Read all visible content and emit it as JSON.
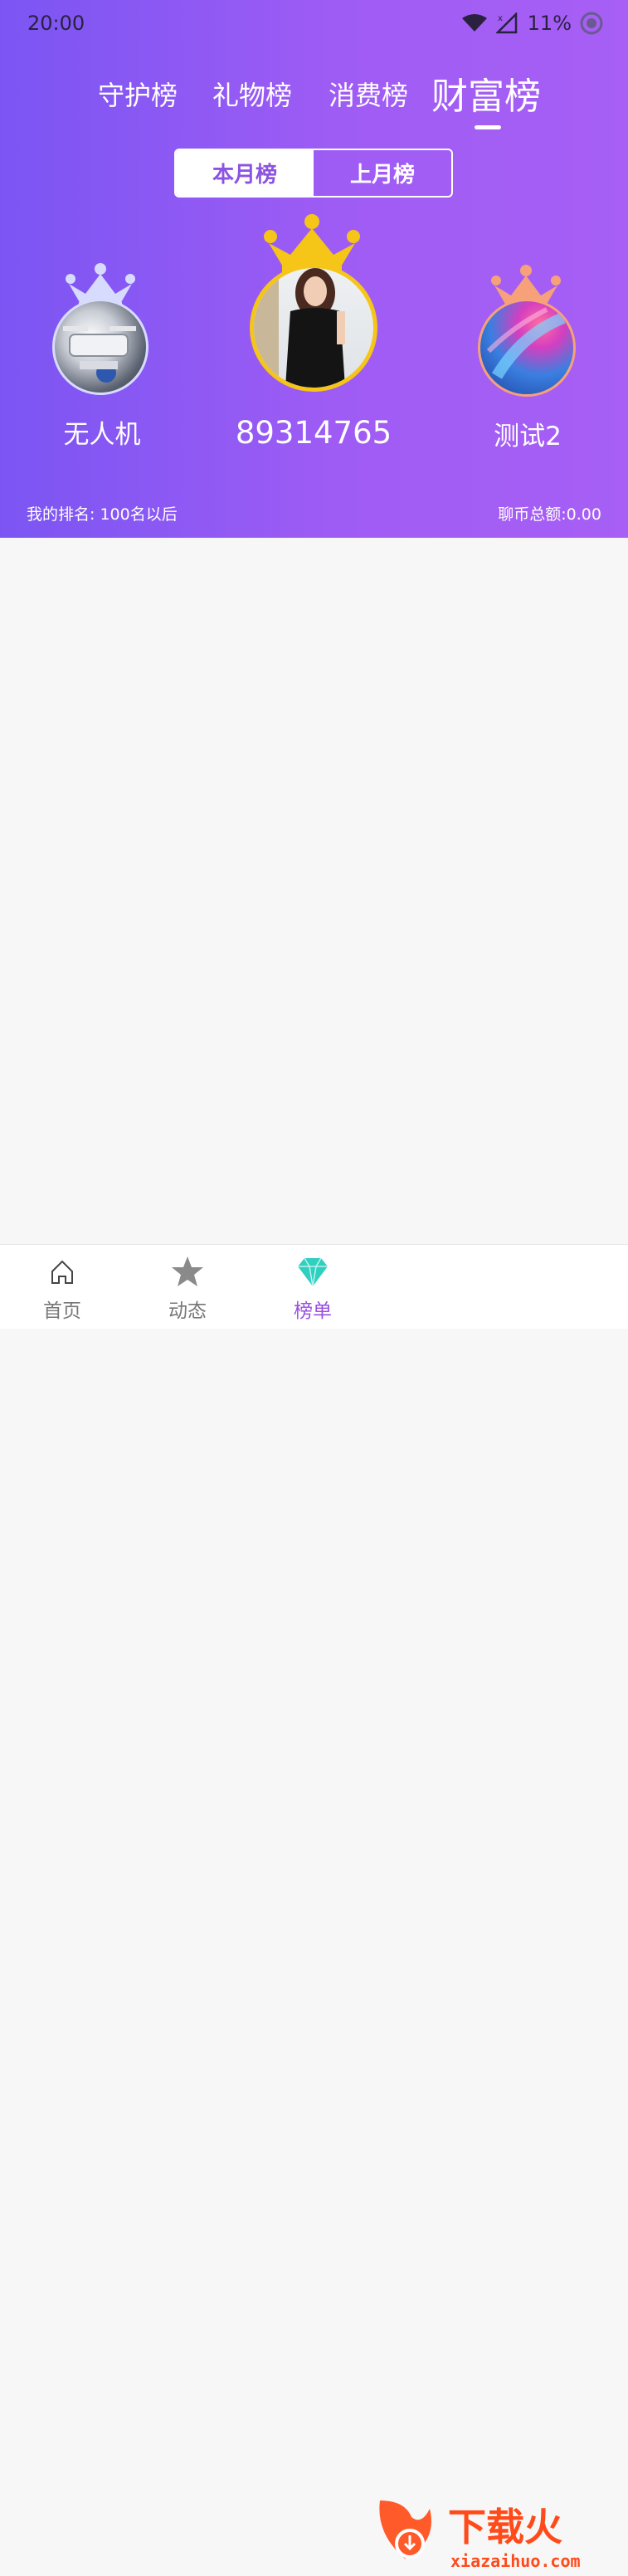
{
  "status_bar": {
    "time": "20:00",
    "battery": "11%"
  },
  "tabs": [
    {
      "label": "守护榜"
    },
    {
      "label": "礼物榜"
    },
    {
      "label": "消费榜"
    },
    {
      "label": "财富榜",
      "active": true
    }
  ],
  "period_toggle": {
    "this_month": "本月榜",
    "last_month": "上月榜",
    "selected": "本月榜"
  },
  "podium": {
    "first": {
      "name": "89314765",
      "crown": "gold-crown-icon"
    },
    "second": {
      "name": "无人机",
      "crown": "silver-crown-icon"
    },
    "third": {
      "name": "测试2",
      "crown": "bronze-crown-icon"
    }
  },
  "my_rank": {
    "label": "我的排名: 100名以后"
  },
  "total": {
    "label": "聊币总额:0.00"
  },
  "bottom_nav": [
    {
      "label": "首页",
      "icon": "home-icon"
    },
    {
      "label": "动态",
      "icon": "star-icon"
    },
    {
      "label": "榜单",
      "icon": "diamond-icon",
      "active": true
    }
  ],
  "watermark": {
    "text": "下载火",
    "domain": "xiazaihuo.com"
  },
  "colors": {
    "accent": "#9b4fe0",
    "gradient_start": "#7b55f3",
    "gradient_end": "#a75ff5",
    "gold": "#f5c518"
  }
}
